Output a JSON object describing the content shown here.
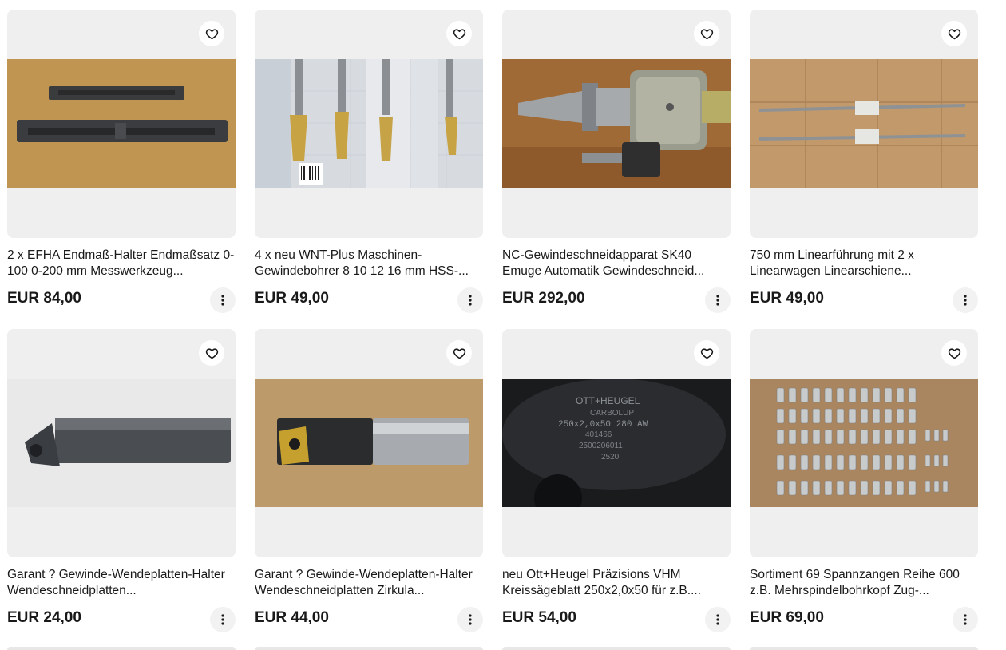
{
  "listings": [
    {
      "title": "2 x EFHA Endmaß-Halter Endmaßsatz 0-100 0-200 mm Messwerkzeug...",
      "price": "EUR 84,00"
    },
    {
      "title": "4 x neu WNT-Plus Maschinen-Gewindebohrer 8 10 12 16 mm HSS-...",
      "price": "EUR 49,00"
    },
    {
      "title": "NC-Gewindeschneidapparat SK40 Emuge Automatik Gewindeschneid...",
      "price": "EUR 292,00"
    },
    {
      "title": "750 mm Linearführung mit 2 x Linearwagen Linearschiene...",
      "price": "EUR 49,00"
    },
    {
      "title": "Garant ? Gewinde-Wendeplatten-Halter Wendeschneidplatten...",
      "price": "EUR 24,00"
    },
    {
      "title": "Garant ? Gewinde-Wendeplatten-Halter Wendeschneidplatten Zirkula...",
      "price": "EUR 44,00"
    },
    {
      "title": "neu Ott+Heugel Präzisions VHM Kreissägeblatt 250x2,0x50 für z.B....",
      "price": "EUR 54,00"
    },
    {
      "title": "Sortiment 69 Spannzangen Reihe 600 z.B. Mehrspindelbohrkopf Zug-...",
      "price": "EUR 69,00"
    }
  ],
  "photo_text": {
    "sawblade_brand": "OTT+HEUGEL",
    "sawblade_material": "CARBOLUP",
    "sawblade_size": "250x2,0x50  280  AW",
    "sawblade_code1": "401466",
    "sawblade_code2": "2500206011",
    "sawblade_code3": "2520"
  },
  "icons": {
    "favorite": "heart-icon",
    "more": "more-vertical-icon"
  }
}
